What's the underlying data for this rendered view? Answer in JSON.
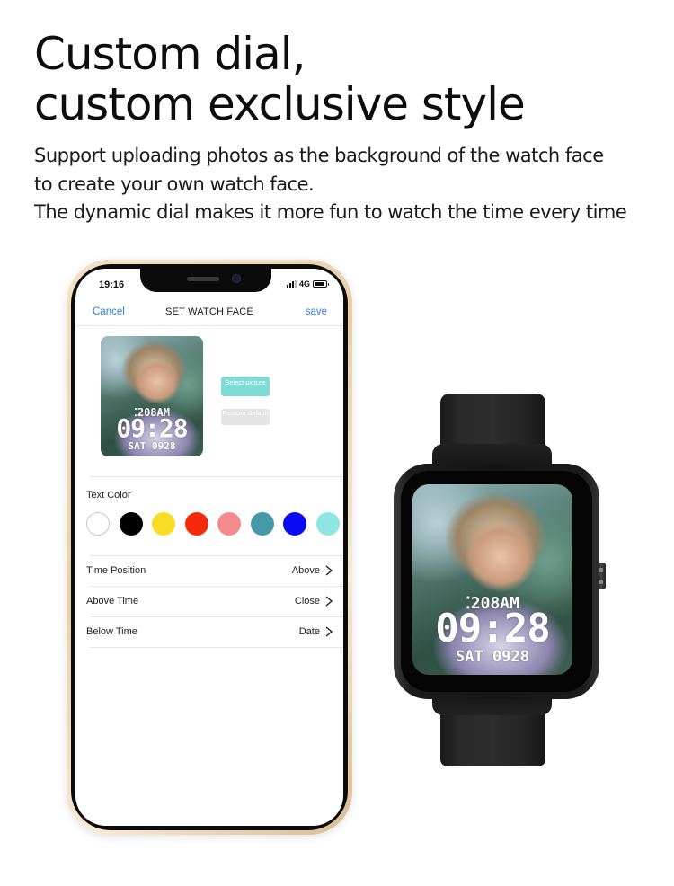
{
  "headline": {
    "line1": "Custom dial,",
    "line2": "custom exclusive style"
  },
  "description": {
    "line1": "Support uploading photos as the background of the watch face",
    "line2": "to create your own watch face.",
    "line3": "The dynamic dial makes it more fun to watch the time every time"
  },
  "phone": {
    "status_bar": {
      "time": "19:16",
      "network": "4G",
      "signal_icon": "signal-bars-icon",
      "battery_icon": "battery-icon",
      "battery_level": 0.9
    },
    "nav": {
      "cancel_label": "Cancel",
      "title": "SET WATCH FACE",
      "save_label": "save"
    },
    "preview": {
      "steps": "208",
      "ampm": "AM",
      "time": "09:28",
      "date": "SAT 0928"
    },
    "buttons": {
      "select_picture": "Select picture",
      "restore_default": "Restore default"
    },
    "text_color": {
      "label": "Text Color",
      "swatches": [
        {
          "name": "white",
          "color": "#ffffff"
        },
        {
          "name": "black",
          "color": "#000000"
        },
        {
          "name": "yellow",
          "color": "#f9dc24"
        },
        {
          "name": "red",
          "color": "#f52a0c"
        },
        {
          "name": "pink",
          "color": "#f58a8c"
        },
        {
          "name": "teal",
          "color": "#4499a8"
        },
        {
          "name": "blue",
          "color": "#0a0af5"
        },
        {
          "name": "aqua",
          "color": "#8ee6e2"
        }
      ]
    },
    "settings": [
      {
        "label": "Time Position",
        "value": "Above"
      },
      {
        "label": "Above Time",
        "value": "Close"
      },
      {
        "label": "Below Time",
        "value": "Date"
      }
    ]
  },
  "watch": {
    "steps": "208",
    "ampm": "AM",
    "time": "09:28",
    "date": "SAT 0928"
  },
  "colors": {
    "link_blue": "#2f7fd9",
    "select_button": "#7edbd6",
    "restore_button": "#e4e4e4",
    "phone_frame_gold": "#e8cfa9"
  }
}
